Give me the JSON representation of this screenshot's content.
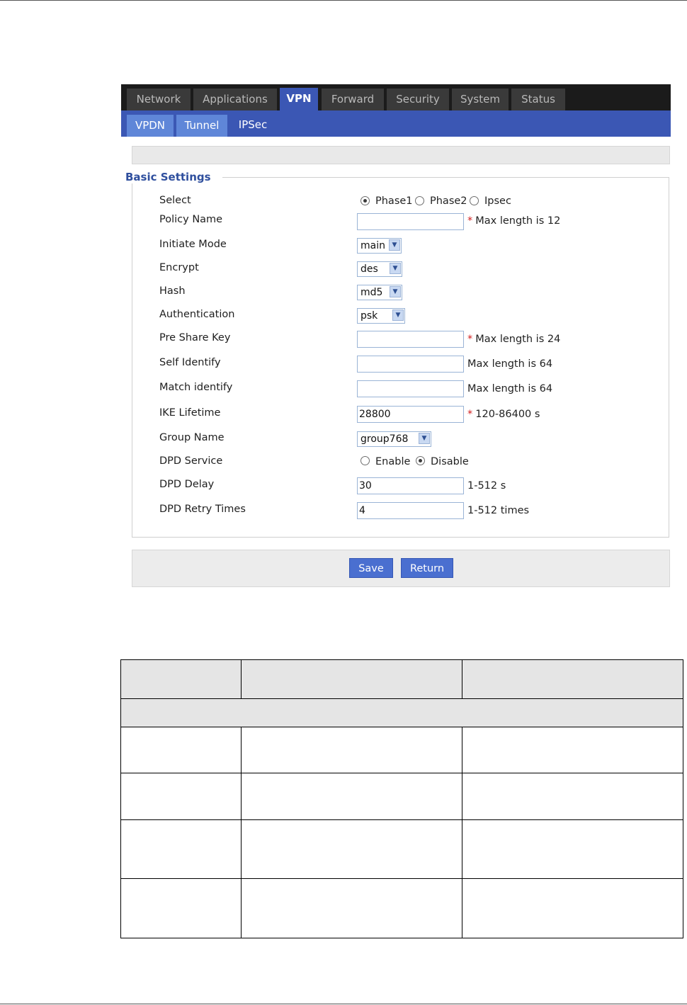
{
  "main_tabs": [
    {
      "label": "Network"
    },
    {
      "label": "Applications"
    },
    {
      "label": "VPN"
    },
    {
      "label": "Forward"
    },
    {
      "label": "Security"
    },
    {
      "label": "System"
    },
    {
      "label": "Status"
    }
  ],
  "active_main_tab": "VPN",
  "sub_tabs": [
    {
      "label": "VPDN"
    },
    {
      "label": "Tunnel"
    },
    {
      "label": "IPSec"
    }
  ],
  "active_sub_tab": "IPSec",
  "section_title": "Basic Settings",
  "form": {
    "select": {
      "label": "Select",
      "options": [
        "Phase1",
        "Phase2",
        "Ipsec"
      ],
      "selected": "Phase1"
    },
    "policy_name": {
      "label": "Policy Name",
      "value": "",
      "required_mark": "*",
      "hint": "Max length is 12"
    },
    "initiate_mode": {
      "label": "Initiate Mode",
      "value": "main"
    },
    "encrypt": {
      "label": "Encrypt",
      "value": "des"
    },
    "hash": {
      "label": "Hash",
      "value": "md5"
    },
    "authentication": {
      "label": "Authentication",
      "value": "psk"
    },
    "pre_share_key": {
      "label": "Pre Share Key",
      "value": "",
      "required_mark": "*",
      "hint": "Max length is 24"
    },
    "self_identify": {
      "label": "Self Identify",
      "value": "",
      "hint": "Max length is 64"
    },
    "match_identify": {
      "label": "Match identify",
      "value": "",
      "hint": "Max length is 64"
    },
    "ike_lifetime": {
      "label": "IKE Lifetime",
      "value": "28800",
      "required_mark": "*",
      "hint": "120-86400 s"
    },
    "group_name": {
      "label": "Group Name",
      "value": "group768"
    },
    "dpd_service": {
      "label": "DPD Service",
      "options": [
        "Enable",
        "Disable"
      ],
      "selected": "Disable"
    },
    "dpd_delay": {
      "label": "DPD Delay",
      "value": "30",
      "hint": "1-512 s"
    },
    "dpd_retry_times": {
      "label": "DPD Retry Times",
      "value": "4",
      "hint": "1-512 times"
    }
  },
  "buttons": {
    "save": "Save",
    "return": "Return"
  },
  "colors": {
    "nav_dark": "#1b1b1b",
    "tab_inactive": "#3a3a3a",
    "accent_blue": "#3b57b4",
    "subtab_inactive": "#5f86d8",
    "required_red": "#d21b1b"
  }
}
